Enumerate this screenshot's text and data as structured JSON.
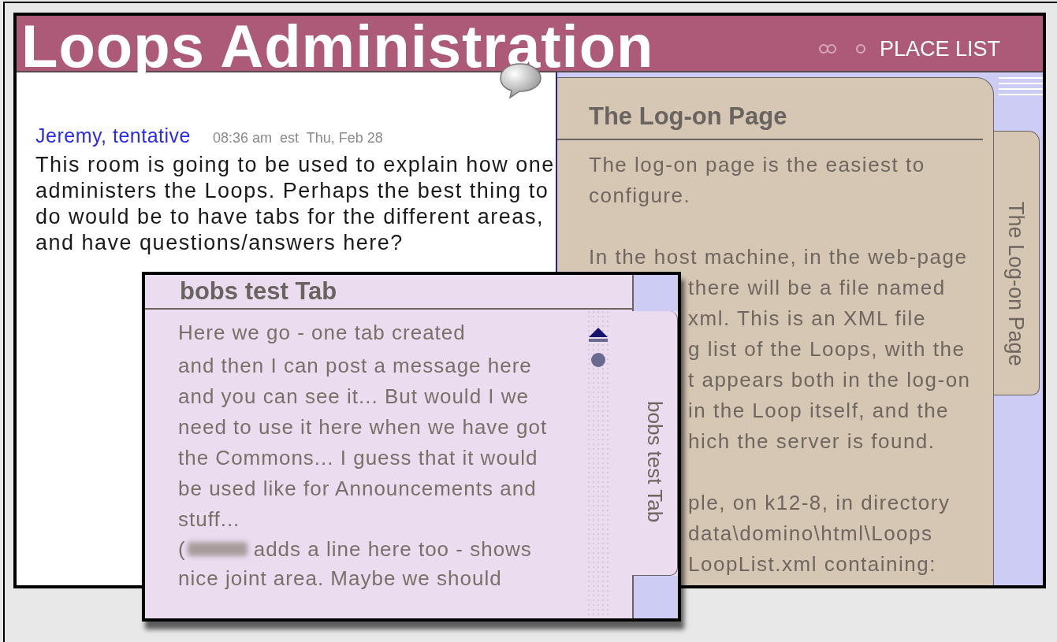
{
  "header": {
    "title": "Loops Administration",
    "place_list": "PLACE LIST"
  },
  "post": {
    "author": "Jeremy, tentative",
    "time": "08:36 am  est  Thu, Feb 28",
    "body": "This room is going to be used to explain how one administers the Loops.  Perhaps the best thing to do would be to have tabs for the different areas, and have questions/answers here?"
  },
  "logon_panel": {
    "title": "The Log-on Page",
    "tab_label": "The Log-on Page",
    "paragraphs": [
      {
        "lines": [
          "The log-on page is the easiest to",
          "configure."
        ]
      },
      {
        "lines": [
          "In the host machine, in the web-page"
        ],
        "cut_lines": [
          "there will be a file named",
          "xml.  This is an XML file",
          "g list of the Loops, with the",
          "t appears both in the log-on",
          "in the Loop itself, and the",
          "hich the server is found."
        ]
      },
      {
        "cut_lines": [
          "ple, on k12-8, in directory",
          "data\\domino\\html\\Loops",
          "LoopList.xml containing:"
        ]
      }
    ]
  },
  "bobs_panel": {
    "title": "bobs test Tab",
    "tab_label": "bobs test Tab",
    "first_line": "Here we go - one tab created",
    "body": "and then I can post a message here and you can see it... But would I we need to use it here when we have got the Commons... I guess that it would be used like for Announcements and stuff...",
    "note_open": "(",
    "note_lines": [
      "adds a line here too - shows",
      "nice joint area. Maybe we should"
    ]
  }
}
